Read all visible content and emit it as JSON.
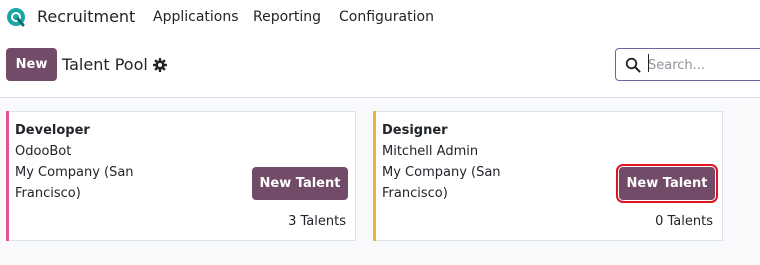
{
  "navbar": {
    "app_name": "Recruitment",
    "menus": [
      "Applications",
      "Reporting",
      "Configuration"
    ],
    "logo_color": "#1aa6a6"
  },
  "control_panel": {
    "new_label": "New",
    "title": "Talent Pool",
    "search_placeholder": "Search..."
  },
  "cards": [
    {
      "name": "Developer",
      "owner": "OdooBot",
      "company_line1": "My Company (San",
      "company_line2": "Francisco)",
      "button_label": "New Talent",
      "count_label": "3 Talents",
      "accent_color": "#e4528f"
    },
    {
      "name": "Designer",
      "owner": "Mitchell Admin",
      "company_line1": "My Company (San",
      "company_line2": "Francisco)",
      "button_label": "New Talent",
      "count_label": "0 Talents",
      "accent_color": "#f0b431"
    }
  ],
  "colors": {
    "primary": "#714b67",
    "highlight_border": "#e0141e"
  }
}
